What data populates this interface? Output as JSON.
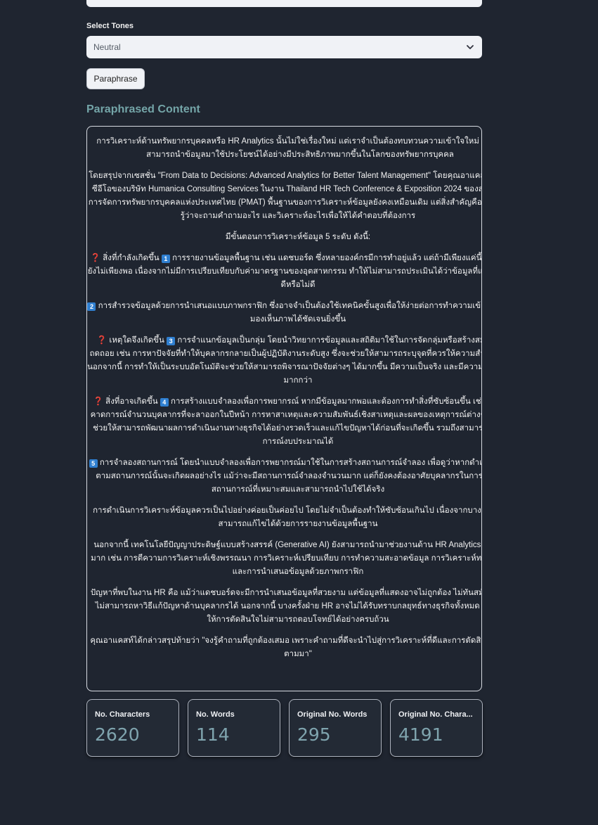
{
  "form": {
    "tones_label": "Select Tones",
    "tone_selected": "Neutral",
    "paraphrase_button": "Paraphrase"
  },
  "result": {
    "title": "Paraphrased Content",
    "paragraphs": {
      "p1": "การวิเคราะห์ด้านทรัพยากรบุคคลหรือ HR Analytics นั้นไม่ใช่เรื่องใหม่ แต่เราจำเป็นต้องทบทวนความเข้าใจใหม่ เพื่อให้สามารถนำข้อมูลมาใช้ประโยชน์ได้อย่างมีประสิทธิภาพมากขึ้นในโลกของทรัพยากรบุคคล",
      "p2": "โดยสรุปจากเซสชั่น \"From Data to Decisions: Advanced Analytics for Better Talent Management\" โดยคุณอาแคสท์ โจชี่ ซีอีโอของบริษัท Humanica Consulting Services ในงาน Thailand HR Tech Conference & Exposition 2024 ของสมาคมการจัดการทรัพยากรบุคคลแห่งประเทศไทย (PMAT) พื้นฐานของการวิเคราะห์ข้อมูลยังคงเหมือนเดิม แต่สิ่งสำคัญคือเราต้องรู้ว่าจะถามคำถามอะไร และวิเคราะห์อะไรเพื่อให้ได้คำตอบที่ต้องการ",
      "p3": "มีขั้นตอนการวิเคราะห์ข้อมูล 5 ระดับ ดังนี้:",
      "p4a": "สิ่งที่กำลังเกิดขึ้น",
      "p4b": "การรายงานข้อมูลพื้นฐาน เช่น แดชบอร์ด ซึ่งหลายองค์กรมีการทำอยู่แล้ว แต่ถ้ามีเพียงแค่นี้ก็ถือว่ายังไม่เพียงพอ เนื่องจากไม่มีการเปรียบเทียบกับค่ามาตรฐานของอุตสาหกรรม ทำให้ไม่สามารถประเมินได้ว่าข้อมูลที่แสดงนั้นดีหรือไม่ดี",
      "p5": "การสำรวจข้อมูลด้วยการนำเสนอแบบภาพกราฟิก ซึ่งอาจจำเป็นต้องใช้เทคนิคขั้นสูงเพื่อให้ง่ายต่อการทำความเข้าใจและมองเห็นภาพได้ชัดเจนยิ่งขึ้น",
      "p6a": "เหตุใดจึงเกิดขึ้น",
      "p6b": "การจำแนกข้อมูลเป็นกลุ่ม โดยนำวิทยาการข้อมูลและสถิติมาใช้ในการจัดกลุ่มหรือสร้างสมการถดถอย เช่น การหาปัจจัยที่ทำให้บุคลากรกลายเป็นผู้ปฏิบัติงานระดับสูง ซึ่งจะช่วยให้สามารถระบุจุดที่ควรให้ความสำคัญได้ นอกจากนี้ การทำให้เป็นระบบอัตโนมัติจะช่วยให้สามารถพิจารณาปัจจัยต่างๆ ได้มากขึ้น มีความเป็นจริง และมีความแม่นยำมากกว่า",
      "p7a": "สิ่งที่อาจเกิดขึ้น",
      "p7b": "การสร้างแบบจำลองเพื่อการพยากรณ์ หากมีข้อมูลมากพอและต้องการทำสิ่งที่ซับซ้อนขึ้น เช่น การคาดการณ์จำนวนบุคลากรที่จะลาออกในปีหน้า การหาสาเหตุและความสัมพันธ์เชิงสาเหตุและผลของเหตุการณ์ต่างๆ ซึ่งจะช่วยให้สามารถพัฒนาผลการดำเนินงานทางธุรกิจได้อย่างรวดเร็วและแก้ไขปัญหาได้ก่อนที่จะเกิดขึ้น รวมถึงสามารถคาดการณ์งบประมาณได้",
      "p8": "การจำลองสถานการณ์ โดยนำแบบจำลองเพื่อการพยากรณ์มาใช้ในการสร้างสถานการณ์จำลอง เพื่อดูว่าหากดำเนินการตามสถานการณ์นั้นจะเกิดผลอย่างไร แม้ว่าจะมีสถานการณ์จำลองจำนวนมาก แต่ก็ยังคงต้องอาศัยบุคลากรในการเลือกสถานการณ์ที่เหมาะสมและสามารถนำไปใช้ได้จริง",
      "p9": "การดำเนินการวิเคราะห์ข้อมูลควรเป็นไปอย่างค่อยเป็นค่อยไป โดยไม่จำเป็นต้องทำให้ซับซ้อนเกินไป เนื่องจากบางปัญหาสามารถแก้ไขได้ด้วยการรายงานข้อมูลพื้นฐาน",
      "p10": "นอกจากนี้ เทคโนโลยีปัญญาประดิษฐ์แบบสร้างสรรค์ (Generative AI) ยังสามารถนำมาช่วยงานด้าน HR Analytics ได้อีกมาก เช่น การตีความการวิเคราะห์เชิงพรรณนา การวิเคราะห์เปรียบเทียบ การทำความสะอาดข้อมูล การวิเคราะห์ทางสถิติ และการนำเสนอข้อมูลด้วยภาพกราฟิก",
      "p11": "ปัญหาที่พบในงาน HR คือ แม้ว่าแดชบอร์ดจะมีการนำเสนอข้อมูลที่สวยงาม แต่ข้อมูลที่แสดงอาจไม่ถูกต้อง ไม่ทันสมัย หรือไม่สามารถหาวิธีแก้ปัญหาด้านบุคลากรได้ นอกจากนี้ บางครั้งฝ่าย HR อาจไม่ได้รับทราบกลยุทธ์ทางธุรกิจทั้งหมด ส่งผลให้การตัดสินใจไม่สามารถตอบโจทย์ได้อย่างครบถ้วน",
      "p12": "คุณอาแคสท์ได้กล่าวสรุปท้ายว่า \"จงรู้คำถามที่ถูกต้องเสมอ เพราะคำถามที่ดีจะนำไปสู่การวิเคราะห์ที่ดีและการตัดสินใจที่ดีตามมา\""
    },
    "keycaps": [
      "1",
      "2",
      "3",
      "4",
      "5"
    ],
    "question_mark": "❓"
  },
  "stats": {
    "characters_label": "No. Characters",
    "characters_value": "2620",
    "words_label": "No. Words",
    "words_value": "114",
    "orig_words_label": "Original No. Words",
    "orig_words_value": "295",
    "orig_chars_label": "Original No. Chara...",
    "orig_chars_value": "4191"
  }
}
